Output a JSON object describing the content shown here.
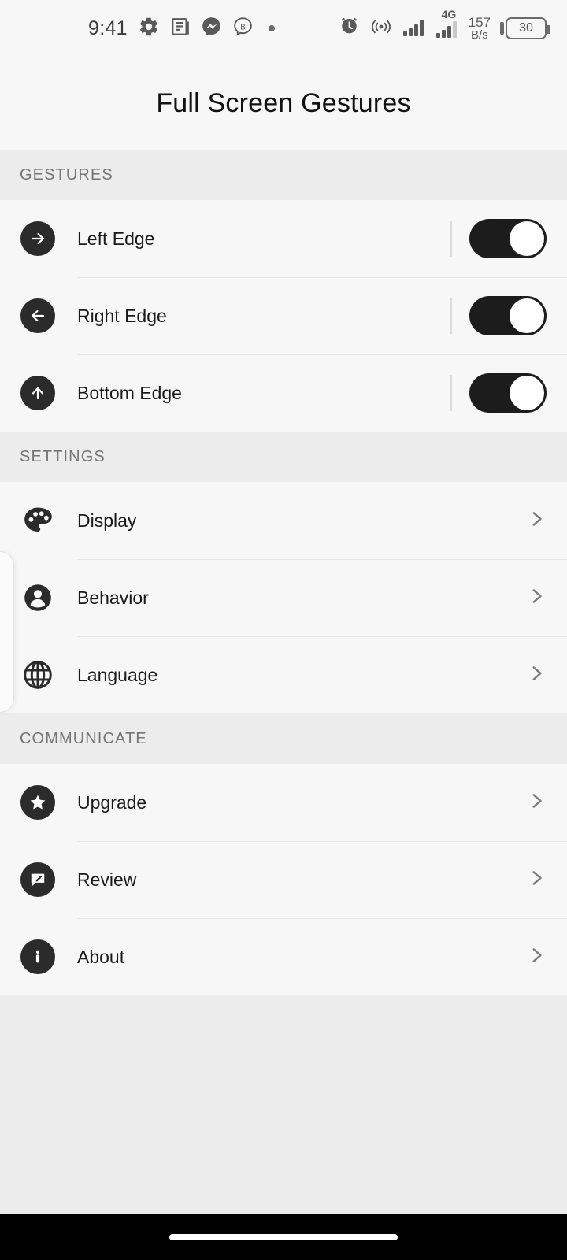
{
  "status_bar": {
    "time": "9:41",
    "left_icons": [
      "gear-icon",
      "news-feed-icon",
      "messenger-icon",
      "b-badge-icon",
      "dot-icon"
    ],
    "right_icons": [
      "alarm-clock-icon",
      "hotspot-icon",
      "signal-bars-icon",
      "signal-4g-icon"
    ],
    "network_type": "4G",
    "network_speed_value": "157",
    "network_speed_unit": "B/s",
    "battery_percent": "30"
  },
  "header": {
    "title": "Full Screen Gestures"
  },
  "sections": [
    {
      "title": "GESTURES",
      "rows": [
        {
          "label": "Left Edge",
          "icon": "arrow-right-icon",
          "control": "toggle",
          "toggle_on": true
        },
        {
          "label": "Right Edge",
          "icon": "arrow-left-icon",
          "control": "toggle",
          "toggle_on": true
        },
        {
          "label": "Bottom Edge",
          "icon": "arrow-up-icon",
          "control": "toggle",
          "toggle_on": true
        }
      ]
    },
    {
      "title": "SETTINGS",
      "rows": [
        {
          "label": "Display",
          "icon": "palette-icon",
          "control": "chevron"
        },
        {
          "label": "Behavior",
          "icon": "person-icon",
          "control": "chevron"
        },
        {
          "label": "Language",
          "icon": "globe-icon",
          "control": "chevron"
        }
      ]
    },
    {
      "title": "COMMUNICATE",
      "rows": [
        {
          "label": "Upgrade",
          "icon": "star-icon",
          "control": "chevron"
        },
        {
          "label": "Review",
          "icon": "review-icon",
          "control": "chevron"
        },
        {
          "label": "About",
          "icon": "info-icon",
          "control": "chevron"
        }
      ]
    }
  ],
  "navigation_bar": {
    "gesture_pill": "home-gesture-pill"
  },
  "colors": {
    "page_background": "#ececec",
    "list_background": "#f7f7f7",
    "icon_dark": "#2b2b2b",
    "toggle_on": "#1c1c1c",
    "section_header_text": "#757575",
    "row_label_text": "#1a1a1a",
    "chevron": "#7d7d7d",
    "nav_bar": "#000000"
  }
}
